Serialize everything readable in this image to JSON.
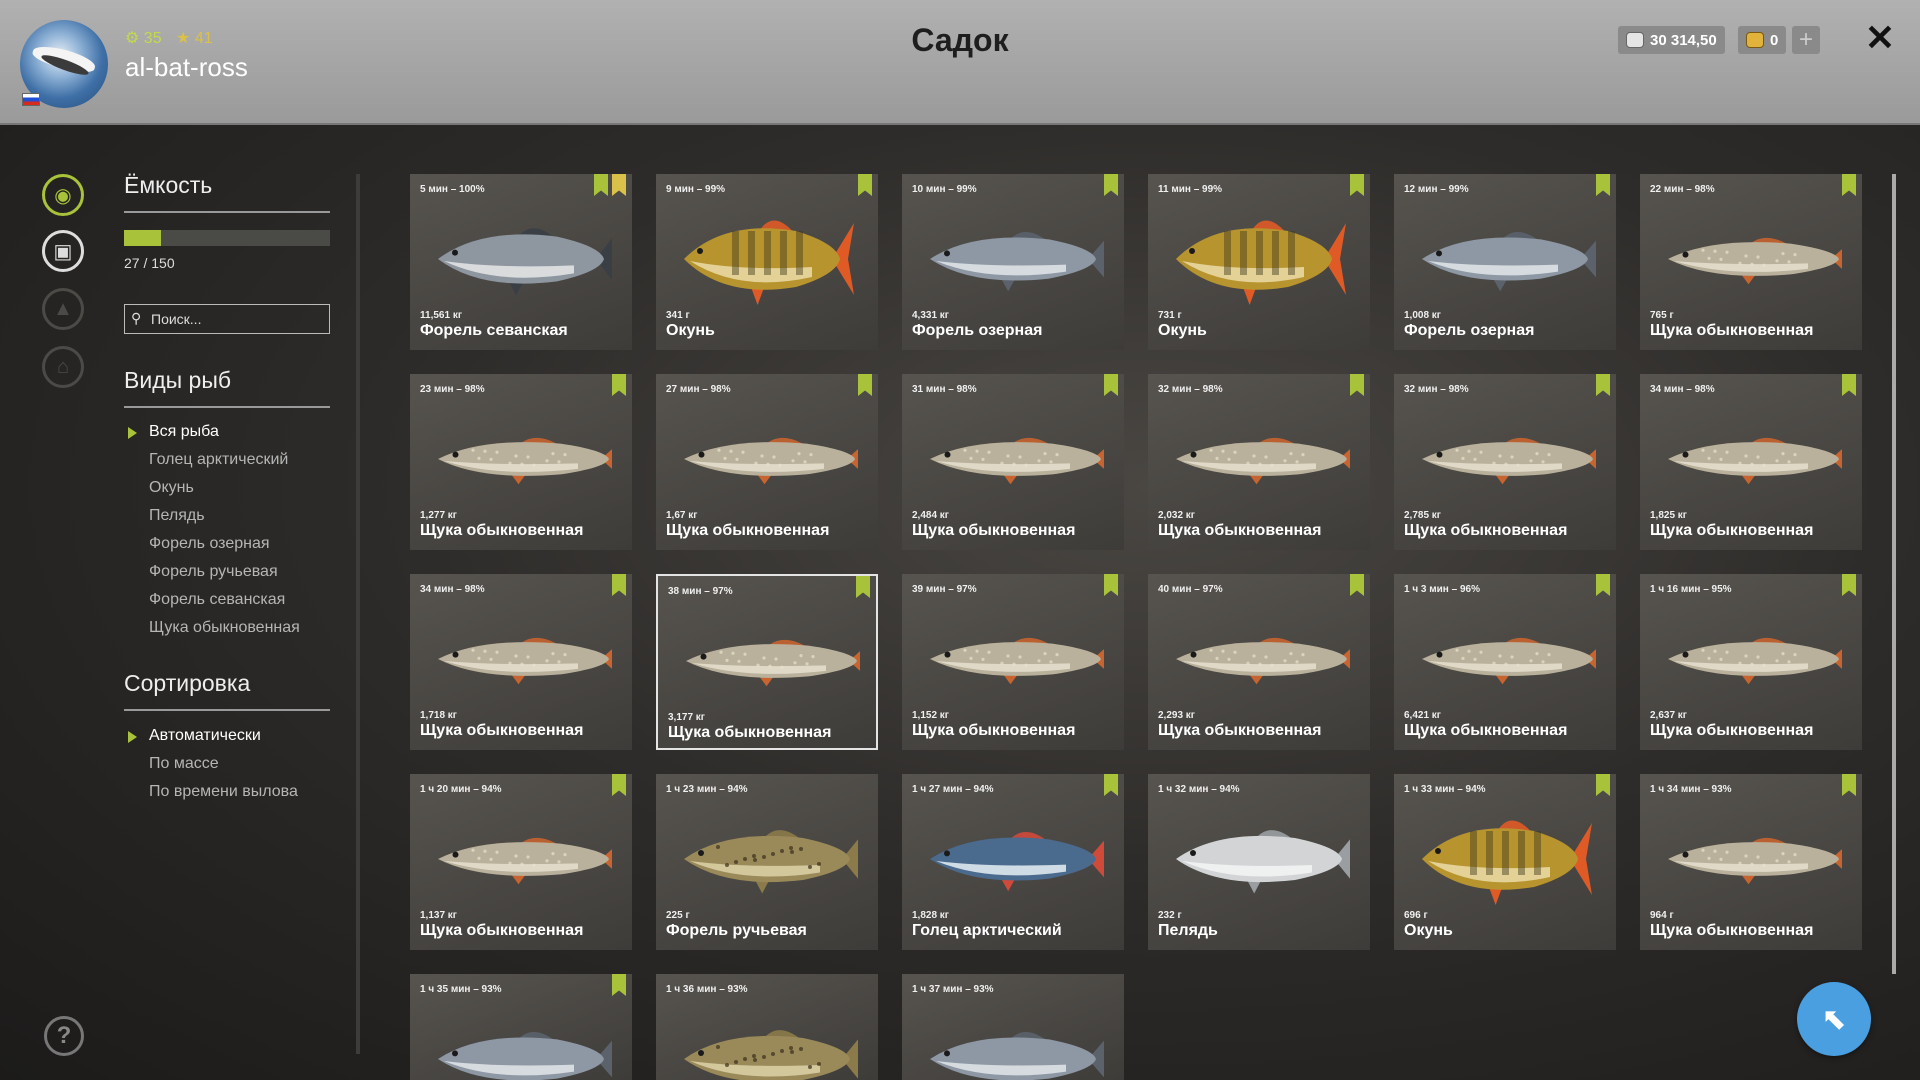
{
  "header": {
    "title": "Садок",
    "username": "al-bat-ross",
    "level": "35",
    "rank": "41",
    "silver": "30 314,50",
    "gold": "0",
    "add_label": "+",
    "close_label": "✕"
  },
  "sidebar": {
    "capacity_title": "Ёмкость",
    "capacity_text": "27 / 150",
    "capacity_used": 27,
    "capacity_total": 150,
    "search_placeholder": "Поиск...",
    "species_title": "Виды рыб",
    "species": [
      {
        "label": "Вся рыба",
        "active": true
      },
      {
        "label": "Голец арктический",
        "active": false
      },
      {
        "label": "Окунь",
        "active": false
      },
      {
        "label": "Пелядь",
        "active": false
      },
      {
        "label": "Форель озерная",
        "active": false
      },
      {
        "label": "Форель ручьевая",
        "active": false
      },
      {
        "label": "Форель севанская",
        "active": false
      },
      {
        "label": "Щука обыкновенная",
        "active": false
      }
    ],
    "sort_title": "Сортировка",
    "sort": [
      {
        "label": "Автоматически",
        "active": true
      },
      {
        "label": "По массе",
        "active": false
      },
      {
        "label": "По времени вылова",
        "active": false
      }
    ]
  },
  "help_label": "?",
  "colors": {
    "accent": "#a8c23a",
    "star": "#d9c14a",
    "fab": "#4a9fe0"
  },
  "fish": [
    {
      "time": "5 мин – 100%",
      "weight": "11,561 кг",
      "name": "Форель севанская",
      "kind": "trout",
      "bookmark": true,
      "star": true
    },
    {
      "time": "9 мин – 99%",
      "weight": "341 г",
      "name": "Окунь",
      "kind": "perch",
      "bookmark": true
    },
    {
      "time": "10 мин – 99%",
      "weight": "4,331 кг",
      "name": "Форель озерная",
      "kind": "laketrout",
      "bookmark": true
    },
    {
      "time": "11 мин – 99%",
      "weight": "731 г",
      "name": "Окунь",
      "kind": "perch",
      "bookmark": true
    },
    {
      "time": "12 мин – 99%",
      "weight": "1,008 кг",
      "name": "Форель озерная",
      "kind": "laketrout",
      "bookmark": true
    },
    {
      "time": "22 мин – 98%",
      "weight": "765 г",
      "name": "Щука обыкновенная",
      "kind": "pike",
      "bookmark": true
    },
    {
      "time": "23 мин – 98%",
      "weight": "1,277 кг",
      "name": "Щука обыкновенная",
      "kind": "pike",
      "bookmark": true
    },
    {
      "time": "27 мин – 98%",
      "weight": "1,67 кг",
      "name": "Щука обыкновенная",
      "kind": "pike",
      "bookmark": true
    },
    {
      "time": "31 мин – 98%",
      "weight": "2,484 кг",
      "name": "Щука обыкновенная",
      "kind": "pike",
      "bookmark": true
    },
    {
      "time": "32 мин – 98%",
      "weight": "2,032 кг",
      "name": "Щука обыкновенная",
      "kind": "pike",
      "bookmark": true
    },
    {
      "time": "32 мин – 98%",
      "weight": "2,785 кг",
      "name": "Щука обыкновенная",
      "kind": "pike",
      "bookmark": true
    },
    {
      "time": "34 мин – 98%",
      "weight": "1,825 кг",
      "name": "Щука обыкновенная",
      "kind": "pike",
      "bookmark": true
    },
    {
      "time": "34 мин – 98%",
      "weight": "1,718 кг",
      "name": "Щука обыкновенная",
      "kind": "pike",
      "bookmark": true
    },
    {
      "time": "38 мин – 97%",
      "weight": "3,177 кг",
      "name": "Щука обыкновенная",
      "kind": "pike",
      "bookmark": true,
      "selected": true
    },
    {
      "time": "39 мин – 97%",
      "weight": "1,152 кг",
      "name": "Щука обыкновенная",
      "kind": "pike",
      "bookmark": true
    },
    {
      "time": "40 мин – 97%",
      "weight": "2,293 кг",
      "name": "Щука обыкновенная",
      "kind": "pike",
      "bookmark": true
    },
    {
      "time": "1 ч 3 мин – 96%",
      "weight": "6,421 кг",
      "name": "Щука обыкновенная",
      "kind": "pike",
      "bookmark": true
    },
    {
      "time": "1 ч 16 мин – 95%",
      "weight": "2,637 кг",
      "name": "Щука обыкновенная",
      "kind": "pike",
      "bookmark": true
    },
    {
      "time": "1 ч 20 мин – 94%",
      "weight": "1,137 кг",
      "name": "Щука обыкновенная",
      "kind": "pike",
      "bookmark": true
    },
    {
      "time": "1 ч 23 мин – 94%",
      "weight": "225 г",
      "name": "Форель ручьевая",
      "kind": "browntrout",
      "bookmark": false
    },
    {
      "time": "1 ч 27 мин – 94%",
      "weight": "1,828 кг",
      "name": "Голец арктический",
      "kind": "char",
      "bookmark": true
    },
    {
      "time": "1 ч 32 мин – 94%",
      "weight": "232 г",
      "name": "Пелядь",
      "kind": "peled",
      "bookmark": false
    },
    {
      "time": "1 ч 33 мин – 94%",
      "weight": "696 г",
      "name": "Окунь",
      "kind": "perch",
      "bookmark": true
    },
    {
      "time": "1 ч 34 мин – 93%",
      "weight": "964 г",
      "name": "Щука обыкновенная",
      "kind": "pike",
      "bookmark": true
    },
    {
      "time": "1 ч 35 мин – 93%",
      "weight": "",
      "name": "",
      "kind": "laketrout",
      "bookmark": true
    },
    {
      "time": "1 ч 36 мин – 93%",
      "weight": "",
      "name": "",
      "kind": "browntrout",
      "bookmark": false
    },
    {
      "time": "1 ч 37 мин – 93%",
      "weight": "",
      "name": "",
      "kind": "laketrout",
      "bookmark": false
    }
  ]
}
